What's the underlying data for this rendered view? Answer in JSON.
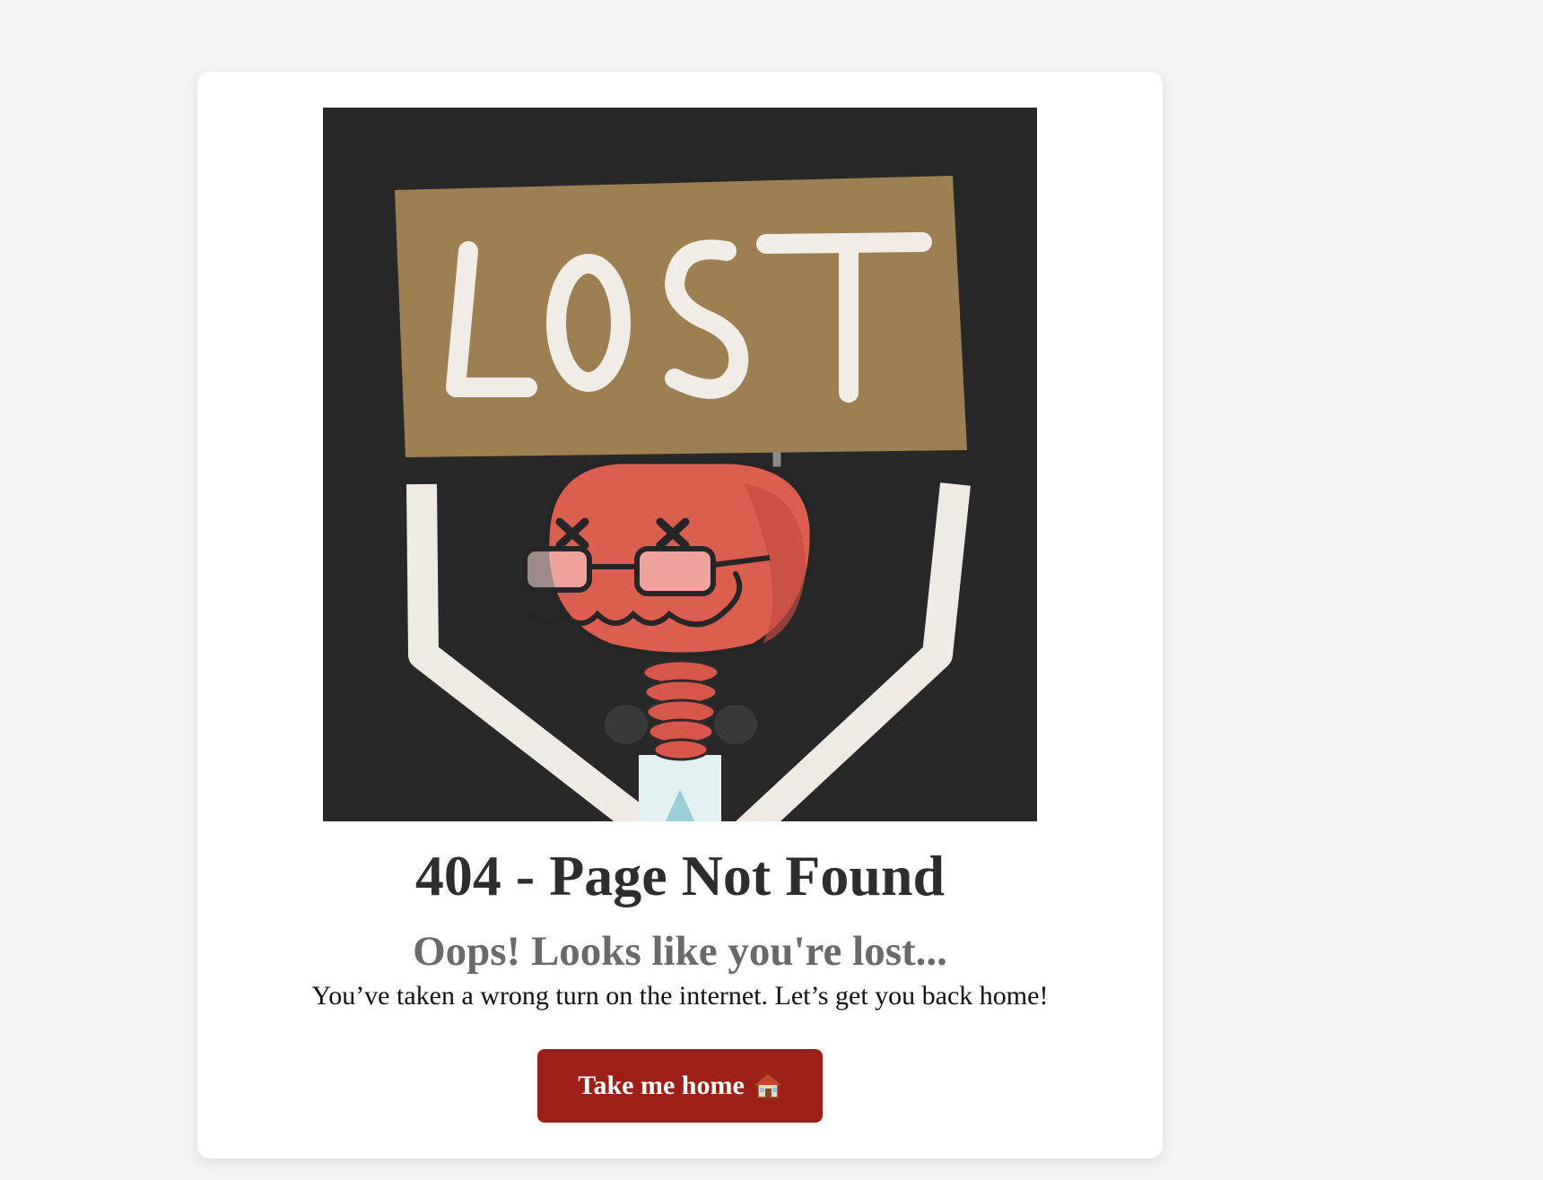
{
  "page": {
    "background": "#f3f3f3"
  },
  "illustration": {
    "sign_text": "LOST",
    "alt": "Lost robot holding a sign"
  },
  "content": {
    "title": "404 - Page Not Found",
    "subtitle": "Oops! Looks like you're lost...",
    "message": "You’ve taken a wrong turn on the internet. Let’s get you back home!"
  },
  "button": {
    "label": "Take me home",
    "icon": "house-icon",
    "color": "#9e1f17"
  }
}
